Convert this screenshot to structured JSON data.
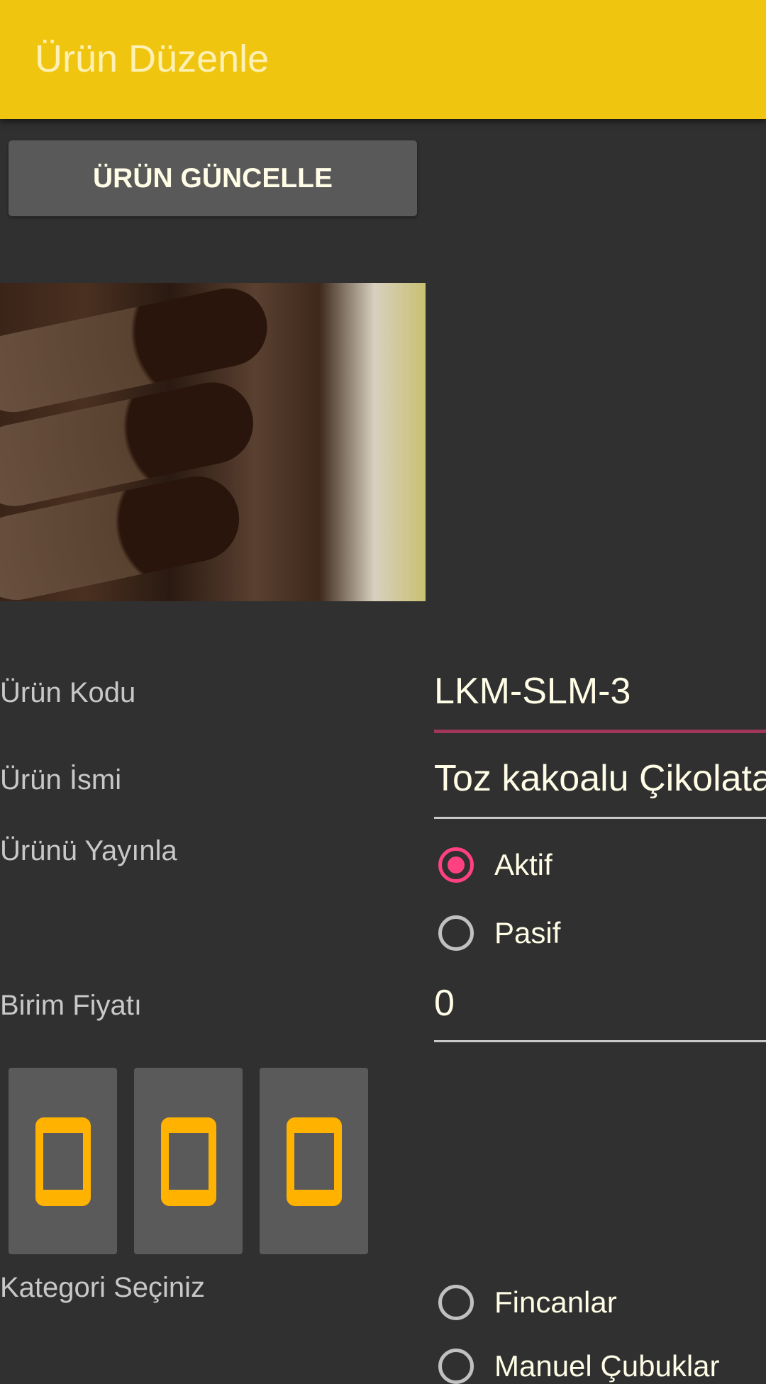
{
  "appbar": {
    "title": "Ürün Düzenle",
    "color": "#F0C510"
  },
  "update_button": {
    "label": "ÜRÜN GÜNCELLE"
  },
  "form": {
    "code": {
      "label": "Ürün Kodu",
      "value": "LKM-SLM-3"
    },
    "name": {
      "label": "Ürün İsmi",
      "value": "Toz kakoalu Çikolatalı"
    },
    "publish": {
      "label": "Ürünü Yayınla",
      "options": [
        {
          "label": "Aktif",
          "checked": true
        },
        {
          "label": "Pasif",
          "checked": false
        }
      ]
    },
    "price": {
      "label": "Birim Fiyatı",
      "value": "0"
    },
    "category": {
      "label": "Kategori Seçiniz",
      "options": [
        {
          "label": "Fincanlar",
          "checked": false
        },
        {
          "label": "Manuel Çubuklar",
          "checked": false
        }
      ]
    }
  },
  "image_slots": [
    {
      "icon": "image-placeholder-icon"
    },
    {
      "icon": "image-placeholder-icon"
    },
    {
      "icon": "image-placeholder-icon"
    }
  ],
  "colors": {
    "accent": "#FF4081",
    "focused_underline": "#A0365A",
    "slot_icon": "#FFB300"
  }
}
